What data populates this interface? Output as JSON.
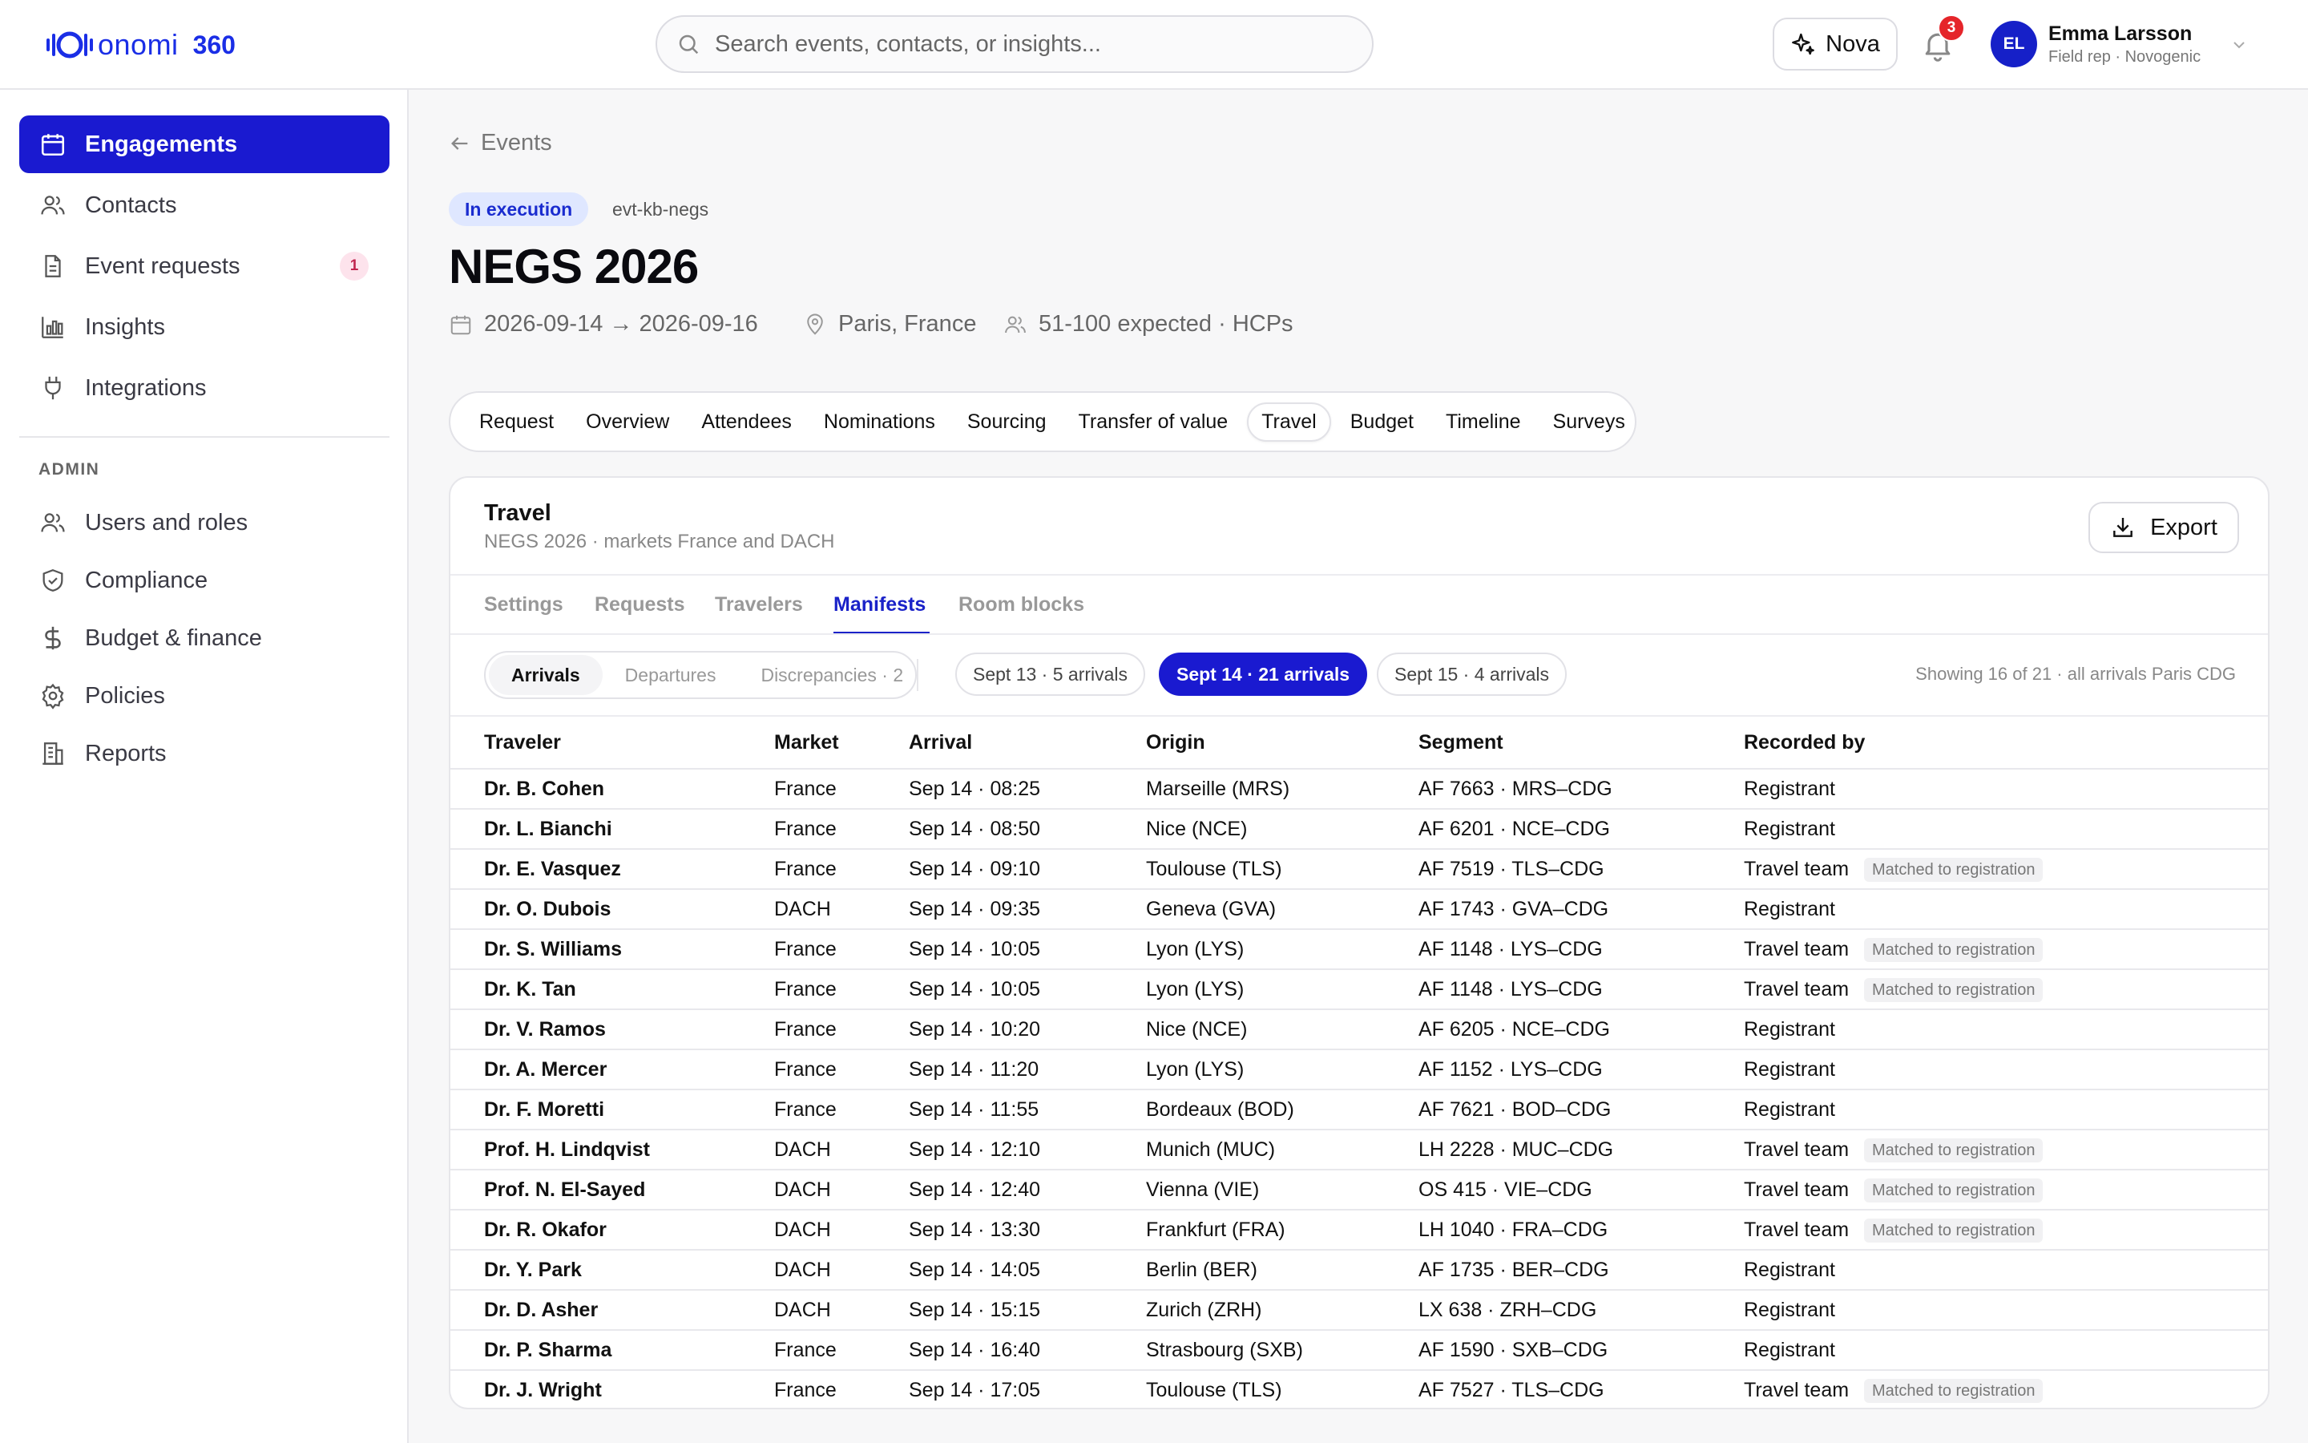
{
  "brand": {
    "wordmark": "onomi",
    "suffix": "360",
    "accent_color": "#1a2ee6"
  },
  "topbar": {
    "search_placeholder": "Search events, contacts, or insights...",
    "nova_label": "Nova",
    "notification_count": "3",
    "user": {
      "initials": "EL",
      "name": "Emma Larsson",
      "role": "Field rep · Novogenic"
    }
  },
  "sidebar": {
    "items": [
      {
        "label": "Engagements",
        "icon": "calendar-icon",
        "active": true
      },
      {
        "label": "Contacts",
        "icon": "users-icon"
      },
      {
        "label": "Event requests",
        "icon": "document-icon",
        "badge": "1"
      },
      {
        "label": "Insights",
        "icon": "bar-chart-icon"
      },
      {
        "label": "Integrations",
        "icon": "plug-icon"
      }
    ],
    "admin_heading": "ADMIN",
    "admin_items": [
      {
        "label": "Users and roles",
        "icon": "users-icon"
      },
      {
        "label": "Compliance",
        "icon": "shield-icon"
      },
      {
        "label": "Budget & finance",
        "icon": "dollar-icon"
      },
      {
        "label": "Policies",
        "icon": "gear-icon"
      },
      {
        "label": "Reports",
        "icon": "building-icon"
      }
    ]
  },
  "event": {
    "back_label": "Events",
    "status": "In execution",
    "id": "evt-kb-negs",
    "title": "NEGS 2026",
    "dates": "2026-09-14 → 2026-09-16",
    "location": "Paris, France",
    "audience": "51-100 expected · HCPs"
  },
  "tabs": [
    "Request",
    "Overview",
    "Attendees",
    "Nominations",
    "Sourcing",
    "Transfer of value",
    "Travel",
    "Budget",
    "Timeline",
    "Surveys"
  ],
  "active_tab": "Travel",
  "travel": {
    "title": "Travel",
    "subtitle": "NEGS 2026 · markets France and DACH",
    "export_label": "Export",
    "subtabs": [
      "Settings",
      "Requests",
      "Travelers",
      "Manifests",
      "Room blocks"
    ],
    "active_subtab": "Manifests",
    "view_toggle": [
      "Arrivals",
      "Departures",
      "Discrepancies · 2"
    ],
    "active_view": "Arrivals",
    "date_chips": [
      "Sept 13 · 5 arrivals",
      "Sept 14 · 21 arrivals",
      "Sept 15 · 4 arrivals"
    ],
    "active_chip": "Sept 14 · 21 arrivals",
    "showing": "Showing 16 of 21 · all arrivals Paris CDG",
    "columns": [
      "Traveler",
      "Market",
      "Arrival",
      "Origin",
      "Segment",
      "Recorded by"
    ],
    "matched_label": "Matched to registration",
    "rows": [
      {
        "traveler": "Dr. B. Cohen",
        "market": "France",
        "arrival": "Sep 14 · 08:25",
        "origin": "Marseille (MRS)",
        "segment": "AF 7663 · MRS–CDG",
        "recorded_by": "Registrant",
        "matched": false
      },
      {
        "traveler": "Dr. L. Bianchi",
        "market": "France",
        "arrival": "Sep 14 · 08:50",
        "origin": "Nice (NCE)",
        "segment": "AF 6201 · NCE–CDG",
        "recorded_by": "Registrant",
        "matched": false
      },
      {
        "traveler": "Dr. E. Vasquez",
        "market": "France",
        "arrival": "Sep 14 · 09:10",
        "origin": "Toulouse (TLS)",
        "segment": "AF 7519 · TLS–CDG",
        "recorded_by": "Travel team",
        "matched": true
      },
      {
        "traveler": "Dr. O. Dubois",
        "market": "DACH",
        "arrival": "Sep 14 · 09:35",
        "origin": "Geneva (GVA)",
        "segment": "AF 1743 · GVA–CDG",
        "recorded_by": "Registrant",
        "matched": false
      },
      {
        "traveler": "Dr. S. Williams",
        "market": "France",
        "arrival": "Sep 14 · 10:05",
        "origin": "Lyon (LYS)",
        "segment": "AF 1148 · LYS–CDG",
        "recorded_by": "Travel team",
        "matched": true
      },
      {
        "traveler": "Dr. K. Tan",
        "market": "France",
        "arrival": "Sep 14 · 10:05",
        "origin": "Lyon (LYS)",
        "segment": "AF 1148 · LYS–CDG",
        "recorded_by": "Travel team",
        "matched": true
      },
      {
        "traveler": "Dr. V. Ramos",
        "market": "France",
        "arrival": "Sep 14 · 10:20",
        "origin": "Nice (NCE)",
        "segment": "AF 6205 · NCE–CDG",
        "recorded_by": "Registrant",
        "matched": false
      },
      {
        "traveler": "Dr. A. Mercer",
        "market": "France",
        "arrival": "Sep 14 · 11:20",
        "origin": "Lyon (LYS)",
        "segment": "AF 1152 · LYS–CDG",
        "recorded_by": "Registrant",
        "matched": false
      },
      {
        "traveler": "Dr. F. Moretti",
        "market": "France",
        "arrival": "Sep 14 · 11:55",
        "origin": "Bordeaux (BOD)",
        "segment": "AF 7621 · BOD–CDG",
        "recorded_by": "Registrant",
        "matched": false
      },
      {
        "traveler": "Prof. H. Lindqvist",
        "market": "DACH",
        "arrival": "Sep 14 · 12:10",
        "origin": "Munich (MUC)",
        "segment": "LH 2228 · MUC–CDG",
        "recorded_by": "Travel team",
        "matched": true
      },
      {
        "traveler": "Prof. N. El-Sayed",
        "market": "DACH",
        "arrival": "Sep 14 · 12:40",
        "origin": "Vienna (VIE)",
        "segment": "OS 415 · VIE–CDG",
        "recorded_by": "Travel team",
        "matched": true
      },
      {
        "traveler": "Dr. R. Okafor",
        "market": "DACH",
        "arrival": "Sep 14 · 13:30",
        "origin": "Frankfurt (FRA)",
        "segment": "LH 1040 · FRA–CDG",
        "recorded_by": "Travel team",
        "matched": true
      },
      {
        "traveler": "Dr. Y. Park",
        "market": "DACH",
        "arrival": "Sep 14 · 14:05",
        "origin": "Berlin (BER)",
        "segment": "AF 1735 · BER–CDG",
        "recorded_by": "Registrant",
        "matched": false
      },
      {
        "traveler": "Dr. D. Asher",
        "market": "DACH",
        "arrival": "Sep 14 · 15:15",
        "origin": "Zurich (ZRH)",
        "segment": "LX 638 · ZRH–CDG",
        "recorded_by": "Registrant",
        "matched": false
      },
      {
        "traveler": "Dr. P. Sharma",
        "market": "France",
        "arrival": "Sep 14 · 16:40",
        "origin": "Strasbourg (SXB)",
        "segment": "AF 1590 · SXB–CDG",
        "recorded_by": "Registrant",
        "matched": false
      },
      {
        "traveler": "Dr. J. Wright",
        "market": "France",
        "arrival": "Sep 14 · 17:05",
        "origin": "Toulouse (TLS)",
        "segment": "AF 7527 · TLS–CDG",
        "recorded_by": "Travel team",
        "matched": true
      }
    ]
  },
  "colors": {
    "primary": "#1a1ad0",
    "status_badge_bg": "#dfe7ff",
    "notification_red": "#e5252a"
  }
}
